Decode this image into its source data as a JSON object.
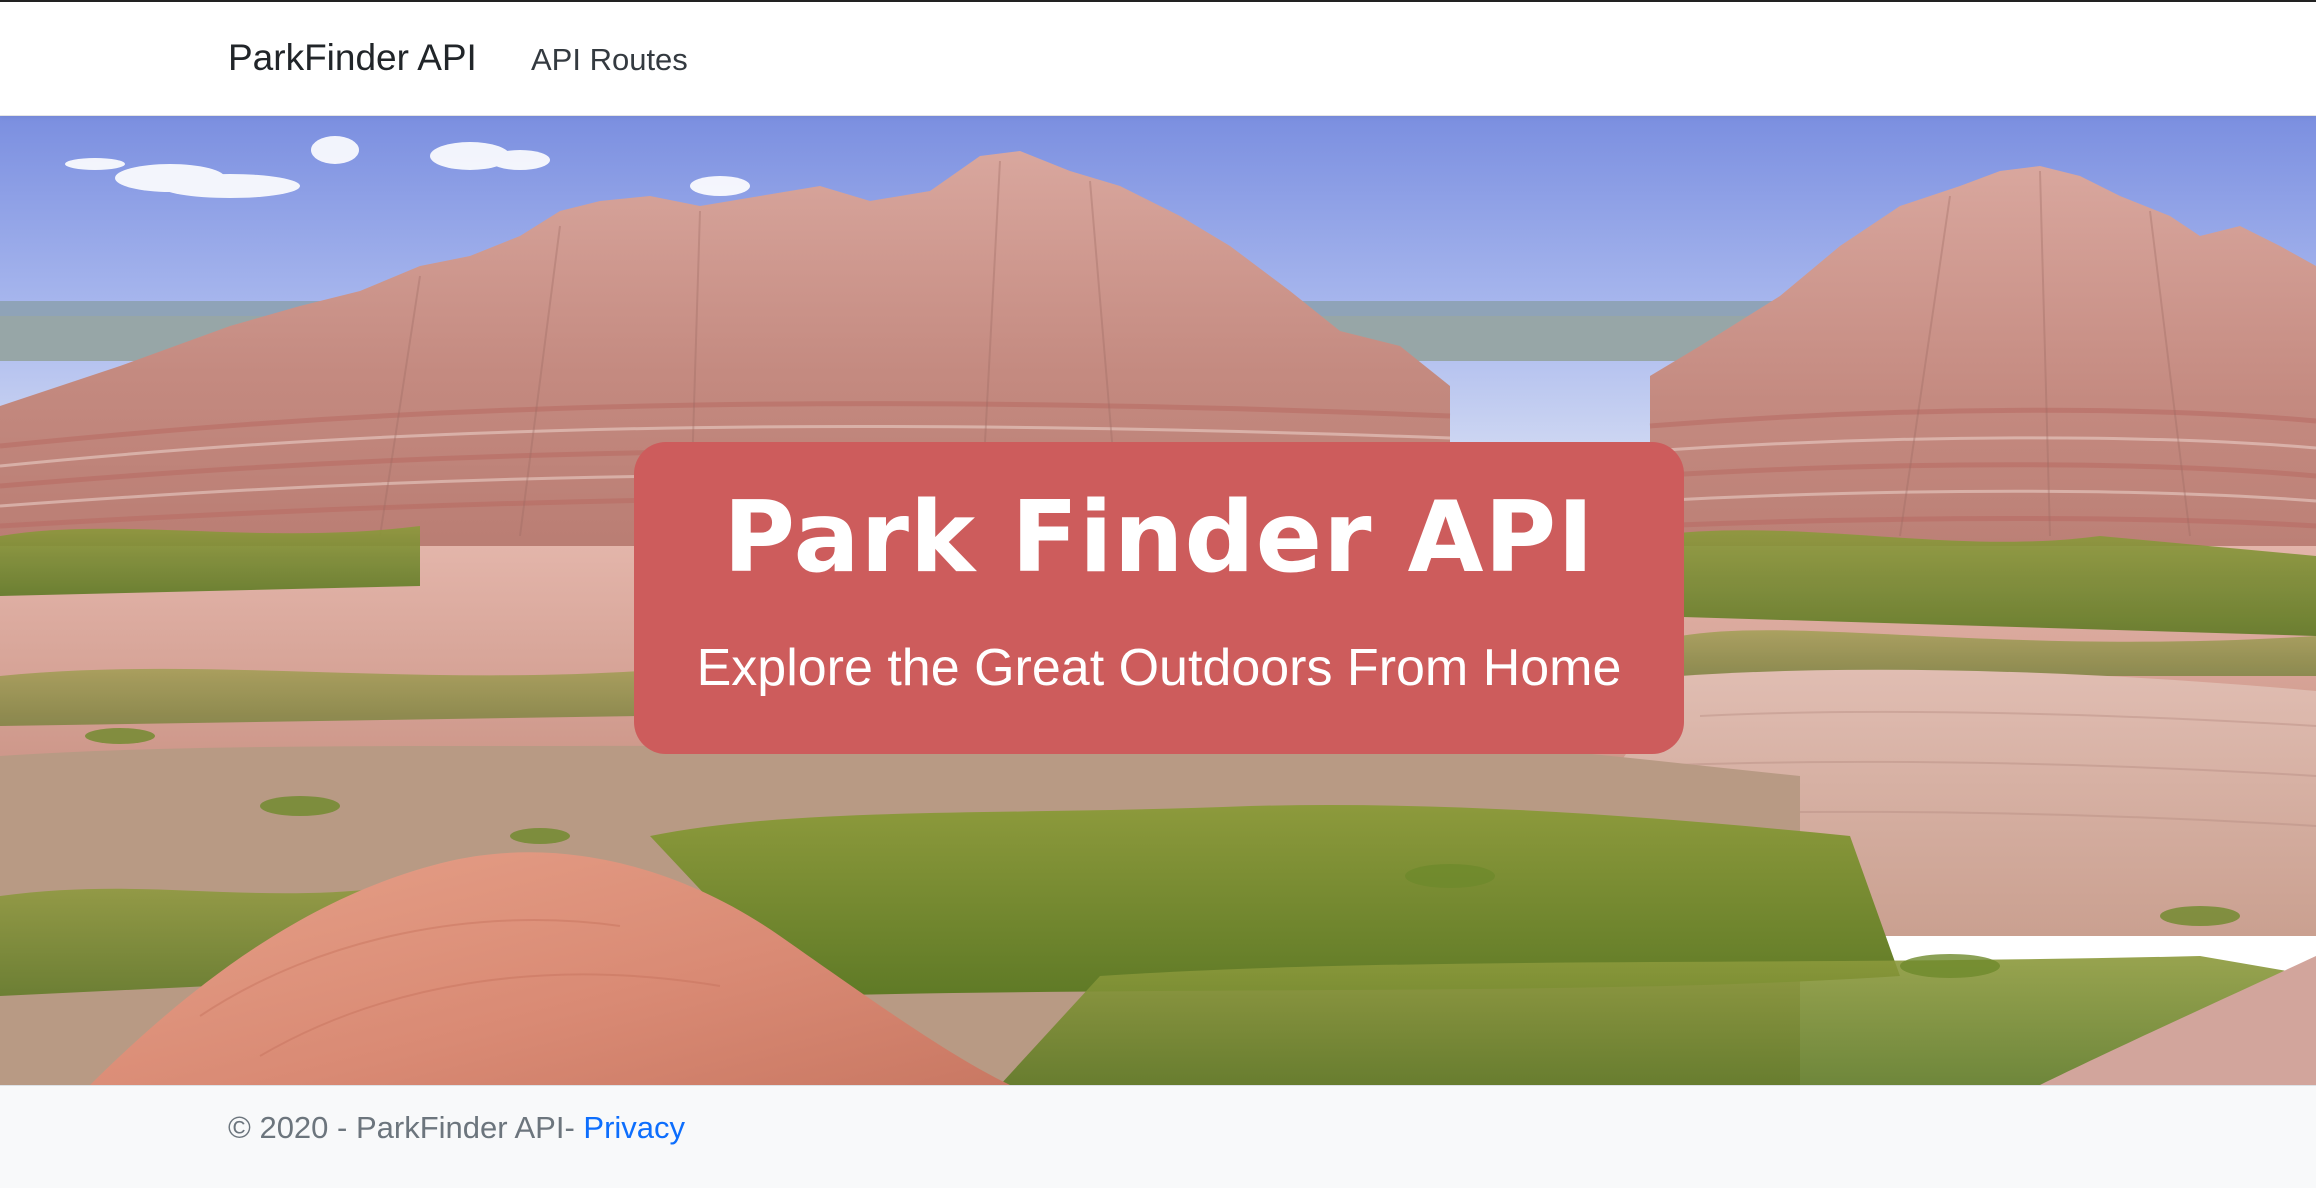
{
  "navbar": {
    "brand": "ParkFinder API",
    "links": [
      {
        "label": "API Routes"
      }
    ]
  },
  "hero": {
    "title": "Park Finder API",
    "subtitle": "Explore the Great Outdoors From Home",
    "card_color": "#cd5c5c",
    "background": "badlands-landscape-photo"
  },
  "footer": {
    "copyright": "© 2020 - ParkFinder API- ",
    "privacy_link": "Privacy"
  },
  "colors": {
    "link": "#0d6efd",
    "footer_text": "#6c757d",
    "footer_bg": "#f8f9fa"
  }
}
